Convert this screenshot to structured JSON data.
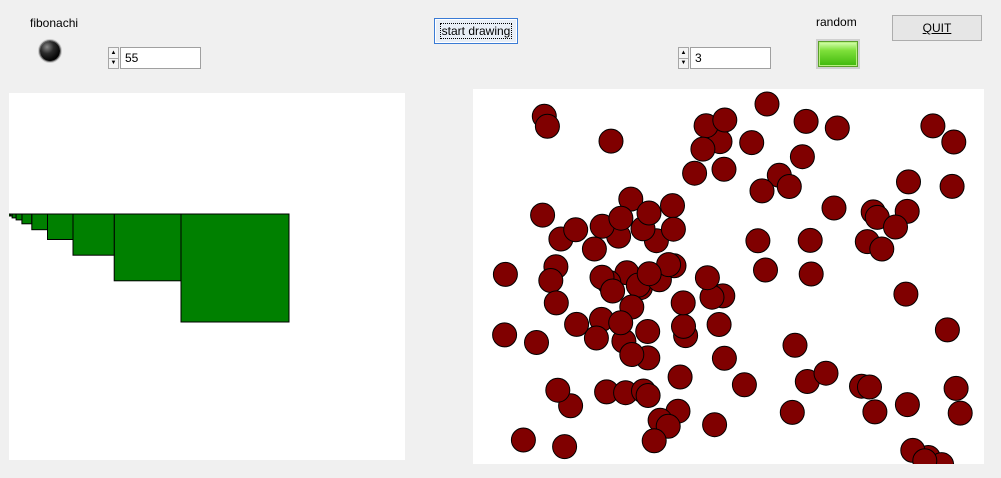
{
  "fibonacci_panel": {
    "label": "fibonachi",
    "indicator_state": "off",
    "value": "55",
    "square_color": "#008000",
    "squares": [
      {
        "side": 55
      },
      {
        "side": 34
      },
      {
        "side": 21
      },
      {
        "side": 13
      },
      {
        "side": 8
      },
      {
        "side": 5
      },
      {
        "side": 3
      },
      {
        "side": 2
      },
      {
        "side": 1
      },
      {
        "side": 1
      }
    ]
  },
  "toolbar": {
    "start_label": "start drawing",
    "quit_label": "QUIT"
  },
  "random_panel": {
    "label": "random",
    "indicator_state": "on",
    "indicator_color": "#5fd11f",
    "value": "3",
    "circle_color": "#800000"
  }
}
